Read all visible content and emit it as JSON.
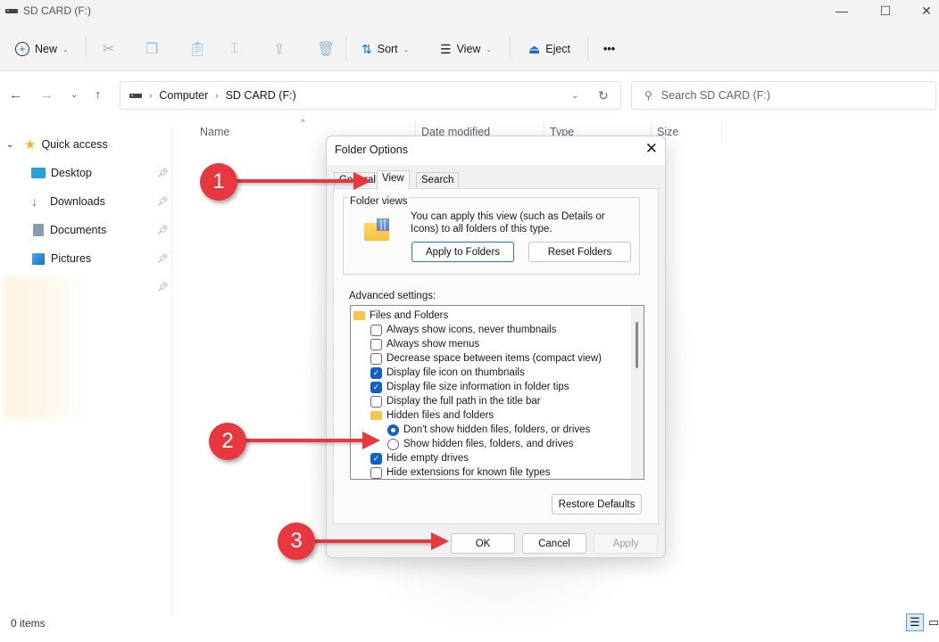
{
  "window": {
    "title": "SD CARD (F:)",
    "controls": {
      "minimize": "—",
      "maximize": "☐",
      "close": "✕"
    }
  },
  "toolbar": {
    "new_label": "New",
    "sort_label": "Sort",
    "view_label": "View",
    "eject_label": "Eject",
    "more_label": "•••",
    "icons": [
      "cut-icon",
      "copy-icon",
      "paste-icon",
      "rename-icon",
      "share-icon",
      "delete-icon"
    ]
  },
  "nav": {
    "breadcrumb": [
      "Computer",
      "SD CARD (F:)"
    ],
    "search_placeholder": "Search SD CARD (F:)"
  },
  "sidebar": {
    "quick_access_label": "Quick access",
    "items": [
      {
        "label": "Desktop",
        "icon": "desktop-icon"
      },
      {
        "label": "Downloads",
        "icon": "downloads-icon"
      },
      {
        "label": "Documents",
        "icon": "documents-icon"
      },
      {
        "label": "Pictures",
        "icon": "pictures-icon"
      },
      {
        "label": "",
        "icon": "blurred-item"
      }
    ]
  },
  "columns": [
    "Name",
    "Date modified",
    "Type",
    "Size"
  ],
  "status": {
    "item_count": "0 items"
  },
  "dialog": {
    "title": "Folder Options",
    "tabs": [
      "General",
      "View",
      "Search"
    ],
    "active_tab": "View",
    "folder_views": {
      "legend": "Folder views",
      "description": "You can apply this view (such as Details or Icons) to all folders of this type.",
      "apply_button": "Apply to Folders",
      "reset_button": "Reset Folders"
    },
    "advanced_label": "Advanced settings:",
    "settings": [
      {
        "type": "folder",
        "label": "Files and Folders",
        "indent": 0
      },
      {
        "type": "checkbox",
        "label": "Always show icons, never thumbnails",
        "checked": false,
        "indent": 1
      },
      {
        "type": "checkbox",
        "label": "Always show menus",
        "checked": false,
        "indent": 1
      },
      {
        "type": "checkbox",
        "label": "Decrease space between items (compact view)",
        "checked": false,
        "indent": 1
      },
      {
        "type": "checkbox",
        "label": "Display file icon on thumbnails",
        "checked": true,
        "indent": 1
      },
      {
        "type": "checkbox",
        "label": "Display file size information in folder tips",
        "checked": true,
        "indent": 1
      },
      {
        "type": "checkbox",
        "label": "Display the full path in the title bar",
        "checked": false,
        "indent": 1
      },
      {
        "type": "folder",
        "label": "Hidden files and folders",
        "indent": 1
      },
      {
        "type": "radio",
        "label": "Don't show hidden files, folders, or drives",
        "checked": true,
        "indent": 2
      },
      {
        "type": "radio",
        "label": "Show hidden files, folders, and drives",
        "checked": false,
        "indent": 2
      },
      {
        "type": "checkbox",
        "label": "Hide empty drives",
        "checked": true,
        "indent": 1
      },
      {
        "type": "checkbox",
        "label": "Hide extensions for known file types",
        "checked": false,
        "indent": 1
      }
    ],
    "restore_defaults": "Restore Defaults",
    "ok": "OK",
    "cancel": "Cancel",
    "apply": "Apply"
  },
  "annotations": [
    {
      "number": "1",
      "target": "View tab"
    },
    {
      "number": "2",
      "target": "Show hidden files, folders, and drives"
    },
    {
      "number": "3",
      "target": "OK button"
    }
  ]
}
